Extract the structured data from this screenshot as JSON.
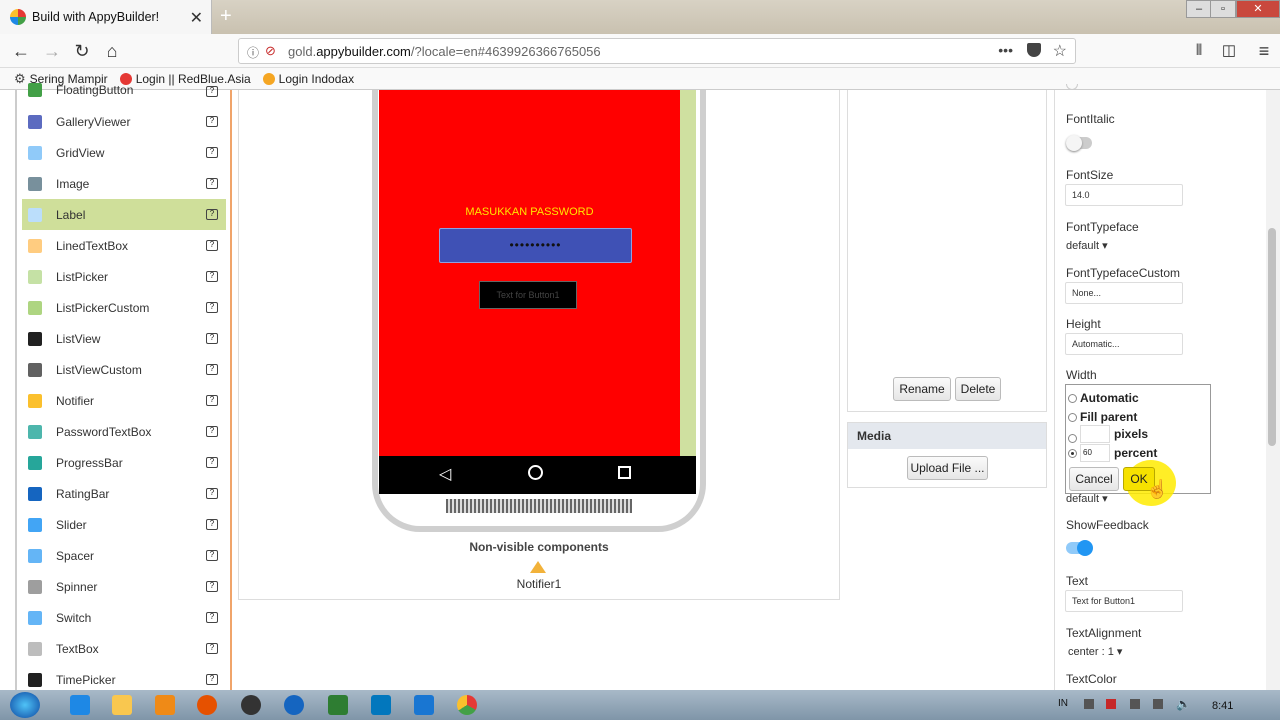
{
  "browser": {
    "tab_title": "Build with AppyBuilder!",
    "tab_close": "✕",
    "new_tab": "+",
    "url_prefix": "gold.",
    "url_domain": "appybuilder.com",
    "url_rest": "/?locale=en#4639926366765056",
    "bookmarks": [
      {
        "label": "Sering Mampir",
        "color": "#444444"
      },
      {
        "label": "Login || RedBlue.Asia",
        "color": "#e53935"
      },
      {
        "label": "Login Indodax",
        "color": "#f5a623"
      }
    ]
  },
  "palette": {
    "items": [
      {
        "label": "FloatingButton",
        "icon": "plus-circle-icon",
        "color": "#43a047"
      },
      {
        "label": "GalleryViewer",
        "icon": "gallery-icon",
        "color": "#5c6bc0"
      },
      {
        "label": "GridView",
        "icon": "grid-icon",
        "color": "#90caf9"
      },
      {
        "label": "Image",
        "icon": "image-icon",
        "color": "#78909c"
      },
      {
        "label": "Label",
        "icon": "label-icon",
        "color": "#bbdefb"
      },
      {
        "label": "LinedTextBox",
        "icon": "lined-textbox-icon",
        "color": "#ffcc80"
      },
      {
        "label": "ListPicker",
        "icon": "listpicker-icon",
        "color": "#c5e1a5"
      },
      {
        "label": "ListPickerCustom",
        "icon": "listpicker-custom-icon",
        "color": "#aed581"
      },
      {
        "label": "ListView",
        "icon": "listview-icon",
        "color": "#212121"
      },
      {
        "label": "ListViewCustom",
        "icon": "listview-custom-icon",
        "color": "#616161"
      },
      {
        "label": "Notifier",
        "icon": "warning-icon",
        "color": "#fbc02d"
      },
      {
        "label": "PasswordTextBox",
        "icon": "password-icon",
        "color": "#4db6ac"
      },
      {
        "label": "ProgressBar",
        "icon": "progressbar-icon",
        "color": "#26a69a"
      },
      {
        "label": "RatingBar",
        "icon": "star-icon",
        "color": "#1565c0"
      },
      {
        "label": "Slider",
        "icon": "slider-icon",
        "color": "#42a5f5"
      },
      {
        "label": "Spacer",
        "icon": "spacer-icon",
        "color": "#64b5f6"
      },
      {
        "label": "Spinner",
        "icon": "spinner-icon",
        "color": "#9e9e9e"
      },
      {
        "label": "Switch",
        "icon": "switch-icon",
        "color": "#64b5f6"
      },
      {
        "label": "TextBox",
        "icon": "textbox-icon",
        "color": "#bdbdbd"
      },
      {
        "label": "TimePicker",
        "icon": "clock-icon",
        "color": "#212121"
      }
    ]
  },
  "viewer": {
    "password_label": "MASUKKAN PASSWORD",
    "password_value": "••••••••••",
    "button_text": "Text for Button1",
    "nonvisible_title": "Non-visible components",
    "notifier_name": "Notifier1"
  },
  "components": {
    "rename": "Rename",
    "delete": "Delete",
    "media_title": "Media",
    "upload": "Upload File ..."
  },
  "properties": {
    "font_italic": "FontItalic",
    "font_size_label": "FontSize",
    "font_size_value": "14.0",
    "font_typeface_label": "FontTypeface",
    "font_typeface_value": "default ▾",
    "font_typeface_custom_label": "FontTypefaceCustom",
    "font_typeface_custom_value": "None...",
    "height_label": "Height",
    "height_value": "Automatic...",
    "width_label": "Width",
    "width_options": {
      "automatic": "Automatic",
      "fill_parent": "Fill parent",
      "pixels": "pixels",
      "percent": "percent",
      "percent_value": "60"
    },
    "cancel": "Cancel",
    "ok": "OK",
    "shape_value": "default ▾",
    "show_feedback_label": "ShowFeedback",
    "text_label": "Text",
    "text_value": "Text for Button1",
    "text_alignment_label": "TextAlignment",
    "text_alignment_value": "center : 1 ▾",
    "text_color_label": "TextColor"
  },
  "taskbar": {
    "lang": "IN",
    "time": "8:41"
  },
  "colors": {
    "screen_bg": "#ff0000",
    "password_bg": "#3f51b5",
    "selected_palette": "#cfdf9a",
    "toggle_on": "#2196f3"
  }
}
